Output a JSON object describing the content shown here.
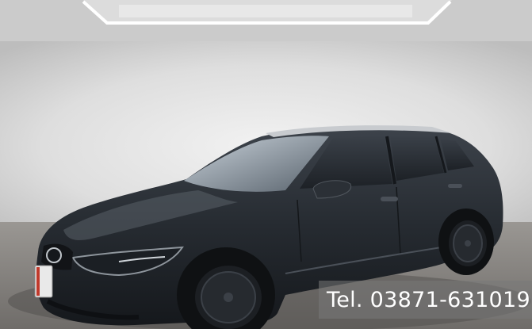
{
  "photo": {
    "subject": "dark gray station wagon",
    "setting": "indoor photo studio with white backdrop and light frame",
    "colors": {
      "backdrop": "#e4e4e4",
      "floor": "#8e8b87",
      "ceiling": "#cfcfcf",
      "car_body": "#2a2f35",
      "overlay": "#787878"
    }
  },
  "overlay": {
    "phone_text": "Tel. 03871-631019"
  }
}
